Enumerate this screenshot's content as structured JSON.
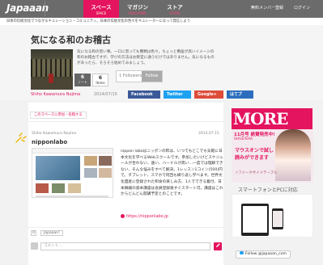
{
  "header": {
    "logo": "Japaaan",
    "nav": [
      {
        "main": "スペース",
        "sub": "SPACE"
      },
      {
        "main": "マガジン",
        "sub": "MAGAZINE"
      },
      {
        "main": "ストア",
        "sub": "STORE"
      }
    ],
    "signup": "無料メンバー登録",
    "login": "ログイン"
  },
  "tagline": "日本の伝統文化でつながるキュレーション・コミュニティ。日本の伝統文化の色々をキュレーターになって発信しよう",
  "space": {
    "title": "気になる和のお稽古",
    "stats": [
      {
        "num": "6",
        "label": "ノート"
      },
      {
        "num": "6",
        "label": "Items"
      }
    ],
    "description": "気になる和の習い事。一口に習っても種類は色々。ちょっと敷居が高いイメージの和のお稽古ですが、学びの方法はお教室に通うだけではありません。気になるものがあったら、そろそろ始めてみましょう。",
    "followers": "1 Followers",
    "follow_button": "Follow"
  },
  "meta": {
    "author": "Shiho Kawamura Nojima",
    "date": "2014/07/15"
  },
  "share": {
    "facebook": "Facebook",
    "twitter": "Twitter",
    "google": "Google+",
    "hatena": "はてブ"
  },
  "tab": "このスペースに参加・投稿する",
  "card": {
    "user": "Shiho Kawamura Nojima",
    "date": "2014.07.15",
    "name": "nipponlabo",
    "description": "nippon laboはニッポンの粋は、いつでもどこでも気軽に日本文化を学べるWebスクールです。参加したいけどスケジュールが合わない、遠い、ハードルが高い…一度では理解できない、そんな悩みをすべて解決。1レッスン1コイン(500)円で。タブレット、スマホで何回も繰り返し学べます。世界文化遺産に登録された和食の楽しみ方、1人でできる着付、日本舞踊の基本講座は会員登録後すぐスタート可。講座はこれからどんどん開講予定とのことです。",
    "link": "https://nipponlabo.jp",
    "like_count": "0",
    "like_label": "Japaaan!",
    "comment_placeholder": "コメント..."
  },
  "sidebar": {
    "ad": {
      "brand": "MORE",
      "issue": "11月号 絶賛発売中!",
      "publisher": "SHUEISHA",
      "copy": "マウスオンで試し読みができます",
      "copy2": "ソファーやサイドテーブル"
    },
    "app_title": "スマートフォンとPCに対応",
    "follow": "Follow @japaaan_com"
  }
}
